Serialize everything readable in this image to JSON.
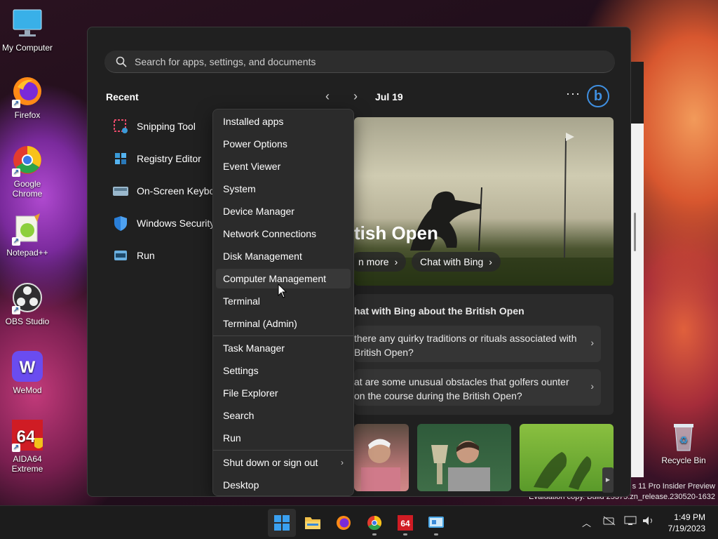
{
  "desktop": {
    "icons": [
      {
        "label": "My Computer"
      },
      {
        "label": "Firefox"
      },
      {
        "label": "Google Chrome"
      },
      {
        "label": "Notepad++"
      },
      {
        "label": "OBS Studio"
      },
      {
        "label": "WeMod"
      },
      {
        "label": "AIDA64 Extreme"
      },
      {
        "label": "Recycle Bin"
      }
    ],
    "watermark_line1": "s 11 Pro Insider Preview",
    "watermark_line2": "Evaluation copy. Build 25375.zn_release.230520-1632"
  },
  "start_menu": {
    "search_placeholder": "Search for apps, settings, and documents",
    "recent_title": "Recent",
    "recent_items": [
      {
        "label": "Snipping Tool"
      },
      {
        "label": "Registry Editor"
      },
      {
        "label": "On-Screen Keybo"
      },
      {
        "label": "Windows Security"
      },
      {
        "label": "Run"
      }
    ],
    "date": "Jul 19",
    "hero_title": "tish Open",
    "hero_buttons": [
      "n more",
      "Chat with Bing"
    ],
    "bing_card_title": "hat with Bing about the British Open",
    "questions": [
      "there any quirky traditions or rituals associated with British Open?",
      "at are some unusual obstacles that golfers ounter on the course during the British Open?"
    ]
  },
  "context_menu": {
    "items": [
      "Installed apps",
      "Power Options",
      "Event Viewer",
      "System",
      "Device Manager",
      "Network Connections",
      "Disk Management",
      "Computer Management",
      "Terminal",
      "Terminal (Admin)",
      "Task Manager",
      "Settings",
      "File Explorer",
      "Search",
      "Run",
      "Shut down or sign out",
      "Desktop"
    ],
    "hovered": "Computer Management"
  },
  "taskbar": {
    "time": "1:49 PM",
    "date": "7/19/2023"
  },
  "colors": {
    "accent": "#3f8fe0",
    "menu_bg": "#202020",
    "context_bg": "#2b2b2b"
  }
}
